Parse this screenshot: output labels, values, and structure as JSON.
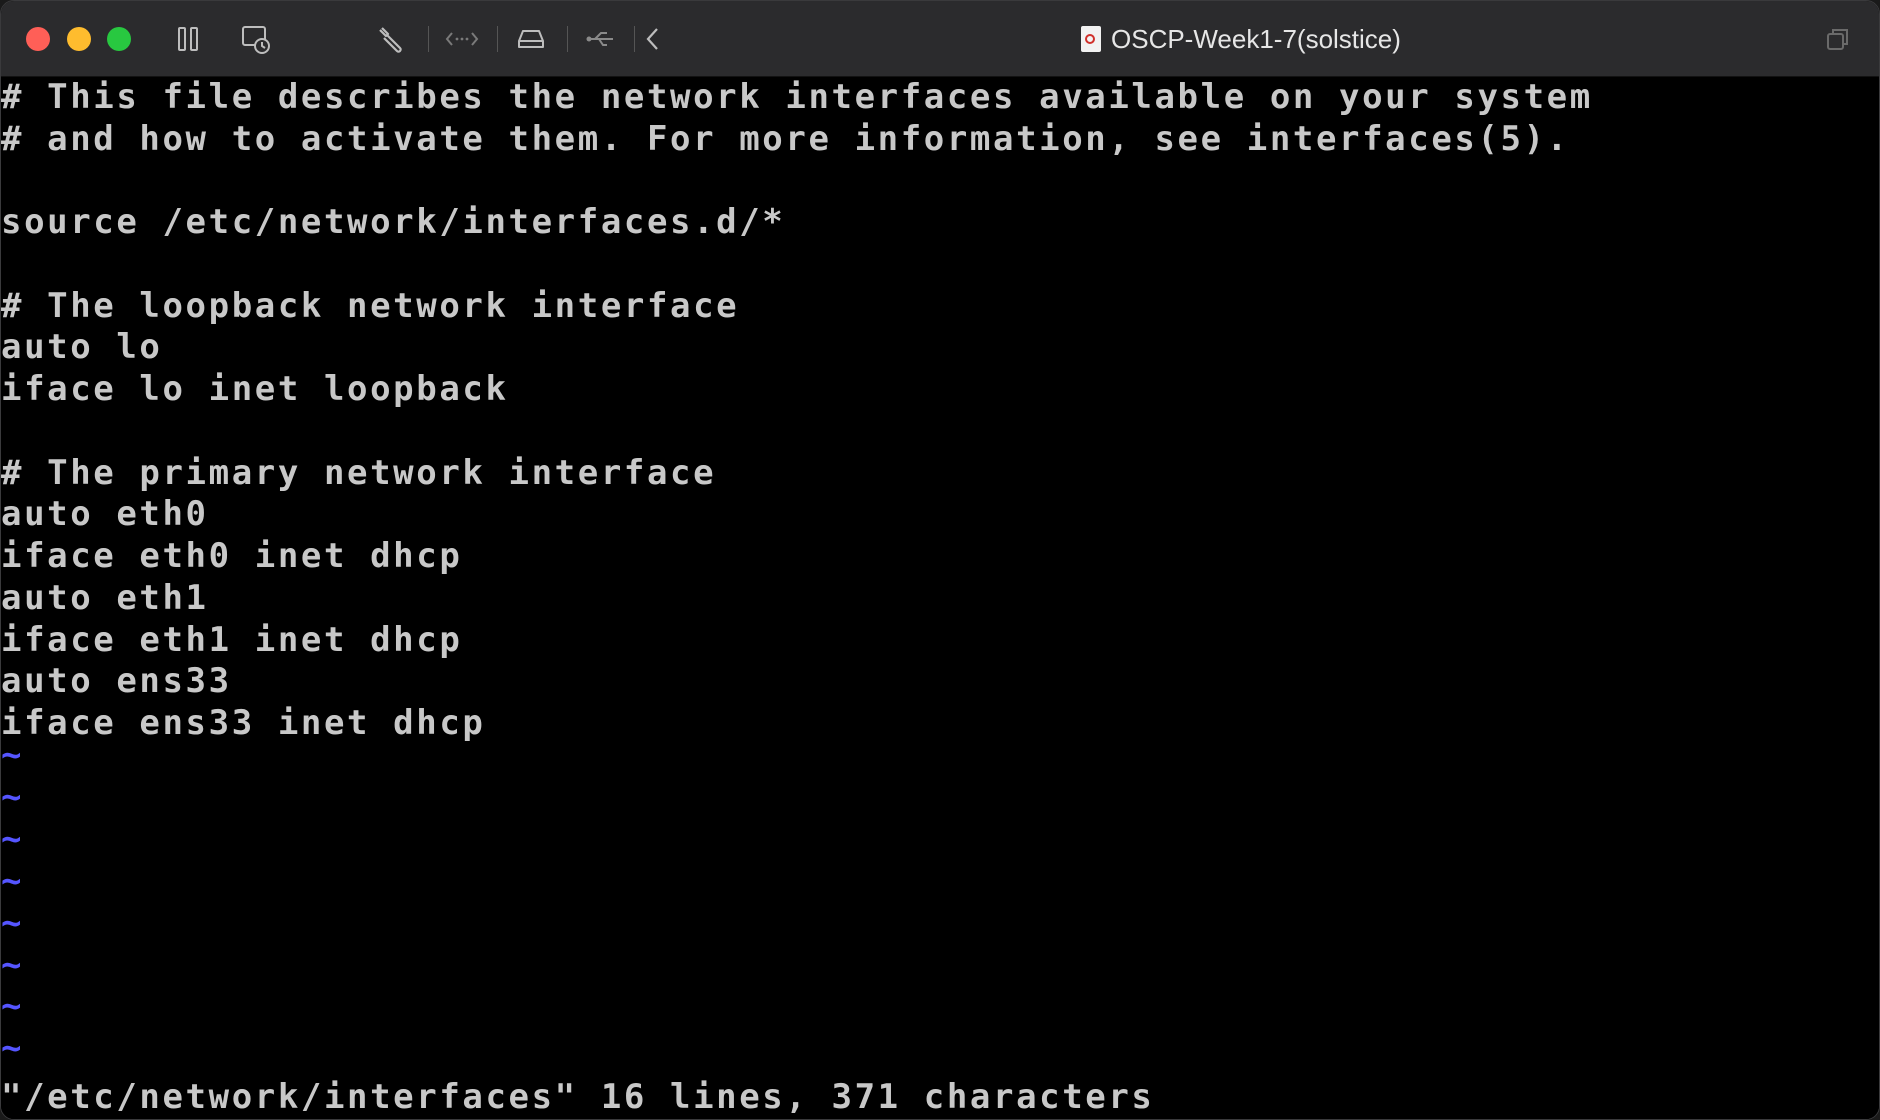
{
  "window": {
    "title": "OSCP-Week1-7(solstice)"
  },
  "toolbar": {
    "icons": [
      "pause-icon",
      "snapshot-icon",
      "settings-wrench-icon",
      "network-arrows-icon",
      "disk-icon",
      "usb-icon",
      "back-chevron-icon",
      "window-restore-icon"
    ]
  },
  "colors": {
    "text": "#c8c8c8",
    "tilde": "#5555ff",
    "background": "#000000",
    "close": "#ff5f57",
    "minimize": "#febc2e",
    "zoom": "#28c840"
  },
  "editor": {
    "lines": [
      "# This file describes the network interfaces available on your system",
      "# and how to activate them. For more information, see interfaces(5).",
      "",
      "source /etc/network/interfaces.d/*",
      "",
      "# The loopback network interface",
      "auto lo",
      "iface lo inet loopback",
      "",
      "# The primary network interface",
      "auto eth0",
      "iface eth0 inet dhcp",
      "auto eth1",
      "iface eth1 inet dhcp",
      "auto ens33",
      "iface ens33 inet dhcp"
    ],
    "tildes": [
      "~",
      "~",
      "~",
      "~",
      "~",
      "~",
      "~",
      "~"
    ],
    "status": "\"/etc/network/interfaces\" 16 lines, 371 characters"
  }
}
